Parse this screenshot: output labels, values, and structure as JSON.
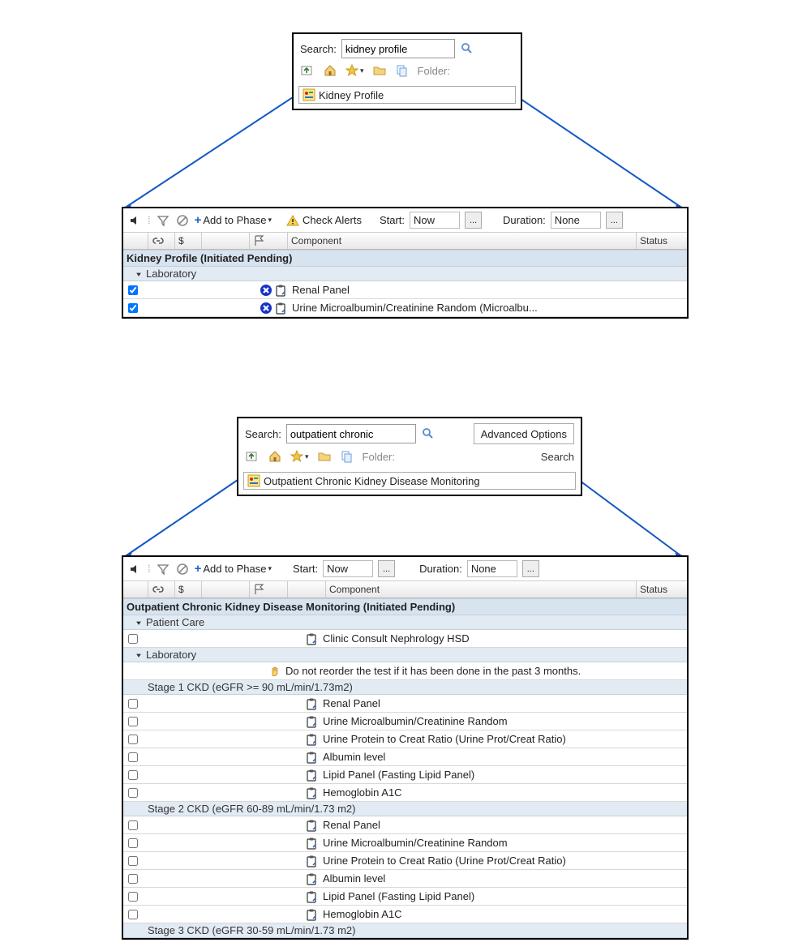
{
  "search1": {
    "label": "Search:",
    "value": "kidney profile",
    "folder_label": "Folder:",
    "result": "Kidney Profile"
  },
  "search2": {
    "label": "Search:",
    "value": "outpatient chronic",
    "folder_label": "Folder:",
    "advanced": "Advanced Options",
    "search_btn": "Search",
    "result": "Outpatient Chronic Kidney Disease Monitoring"
  },
  "order1": {
    "add_phase": "Add to Phase",
    "check_alerts": "Check Alerts",
    "start_label": "Start:",
    "start_value": "Now",
    "duration_label": "Duration:",
    "duration_value": "None",
    "headers": {
      "component": "Component",
      "status": "Status",
      "dollar": "$"
    },
    "title": "Kidney Profile (Initiated Pending)",
    "group": "Laboratory",
    "rows": [
      {
        "checked": true,
        "component": "Renal Panel"
      },
      {
        "checked": true,
        "component": "Urine Microalbumin/Creatinine Random (Microalbu..."
      }
    ]
  },
  "order2": {
    "add_phase": "Add to Phase",
    "start_label": "Start:",
    "start_value": "Now",
    "duration_label": "Duration:",
    "duration_value": "None",
    "headers": {
      "component": "Component",
      "status": "Status",
      "dollar": "$"
    },
    "title": "Outpatient Chronic Kidney Disease Monitoring (Initiated Pending)",
    "groups": [
      {
        "name": "Patient Care",
        "rows": [
          {
            "checked": false,
            "component": "Clinic Consult Nephrology HSD",
            "clipboard": true
          }
        ]
      },
      {
        "name": "Laboratory",
        "note": "Do not reorder the test if it has been done in the past 3 months.",
        "stages": [
          {
            "label": "Stage 1 CKD (eGFR >= 90 mL/min/1.73m2)",
            "rows": [
              {
                "component": "Renal Panel"
              },
              {
                "component": "Urine Microalbumin/Creatinine Random"
              },
              {
                "component": "Urine Protein to Creat Ratio (Urine Prot/Creat Ratio)"
              },
              {
                "component": "Albumin level"
              },
              {
                "component": "Lipid Panel (Fasting Lipid Panel)"
              },
              {
                "component": "Hemoglobin A1C"
              }
            ]
          },
          {
            "label": "Stage 2 CKD (eGFR 60-89 mL/min/1.73 m2)",
            "rows": [
              {
                "component": "Renal Panel"
              },
              {
                "component": "Urine Microalbumin/Creatinine Random"
              },
              {
                "component": "Urine Protein to Creat Ratio (Urine Prot/Creat Ratio)"
              },
              {
                "component": "Albumin level"
              },
              {
                "component": "Lipid Panel (Fasting Lipid Panel)"
              },
              {
                "component": "Hemoglobin A1C"
              }
            ]
          },
          {
            "label": "Stage 3 CKD (eGFR 30-59 mL/min/1.73 m2)",
            "rows": []
          }
        ]
      }
    ]
  }
}
